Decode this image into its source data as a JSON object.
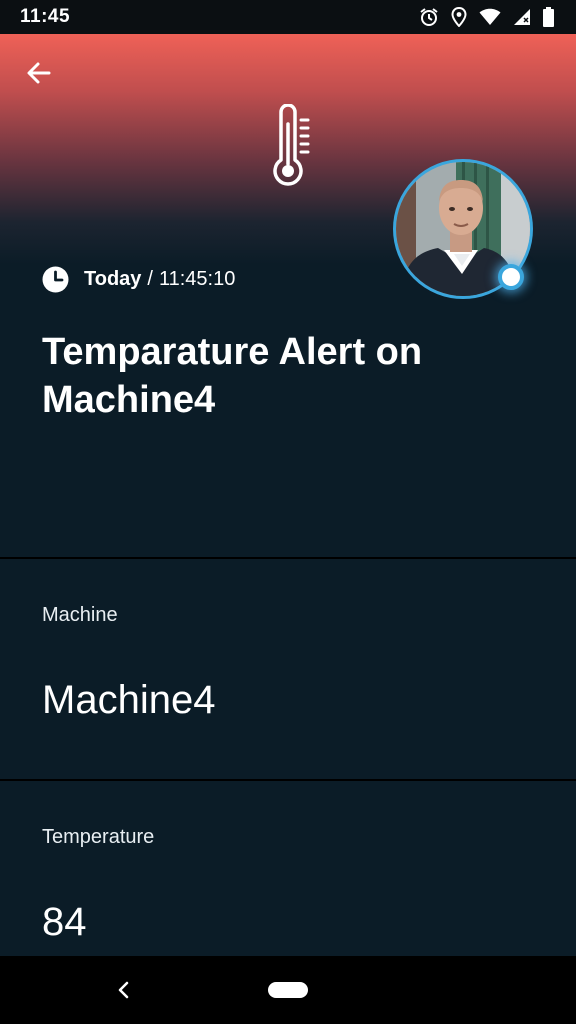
{
  "status_bar": {
    "time": "11:45",
    "icons": [
      "alarm-icon",
      "location-icon",
      "wifi-icon",
      "signal-icon",
      "battery-icon"
    ]
  },
  "header": {
    "back_icon": "back-arrow-icon",
    "alert_icon": "thermometer-icon",
    "gradient_colors": [
      "#ef6157",
      "#0b1c27"
    ],
    "avatar_ring_color": "#3aa6dd"
  },
  "alert": {
    "day": "Today",
    "separator": "/",
    "time": "11:45:10",
    "title": "Temparature Alert on Machine4"
  },
  "fields": [
    {
      "label": "Machine",
      "value": "Machine4"
    },
    {
      "label": "Temperature",
      "value": "84"
    }
  ],
  "colors": {
    "background": "#0b1c27",
    "accent": "#3aa6dd"
  }
}
